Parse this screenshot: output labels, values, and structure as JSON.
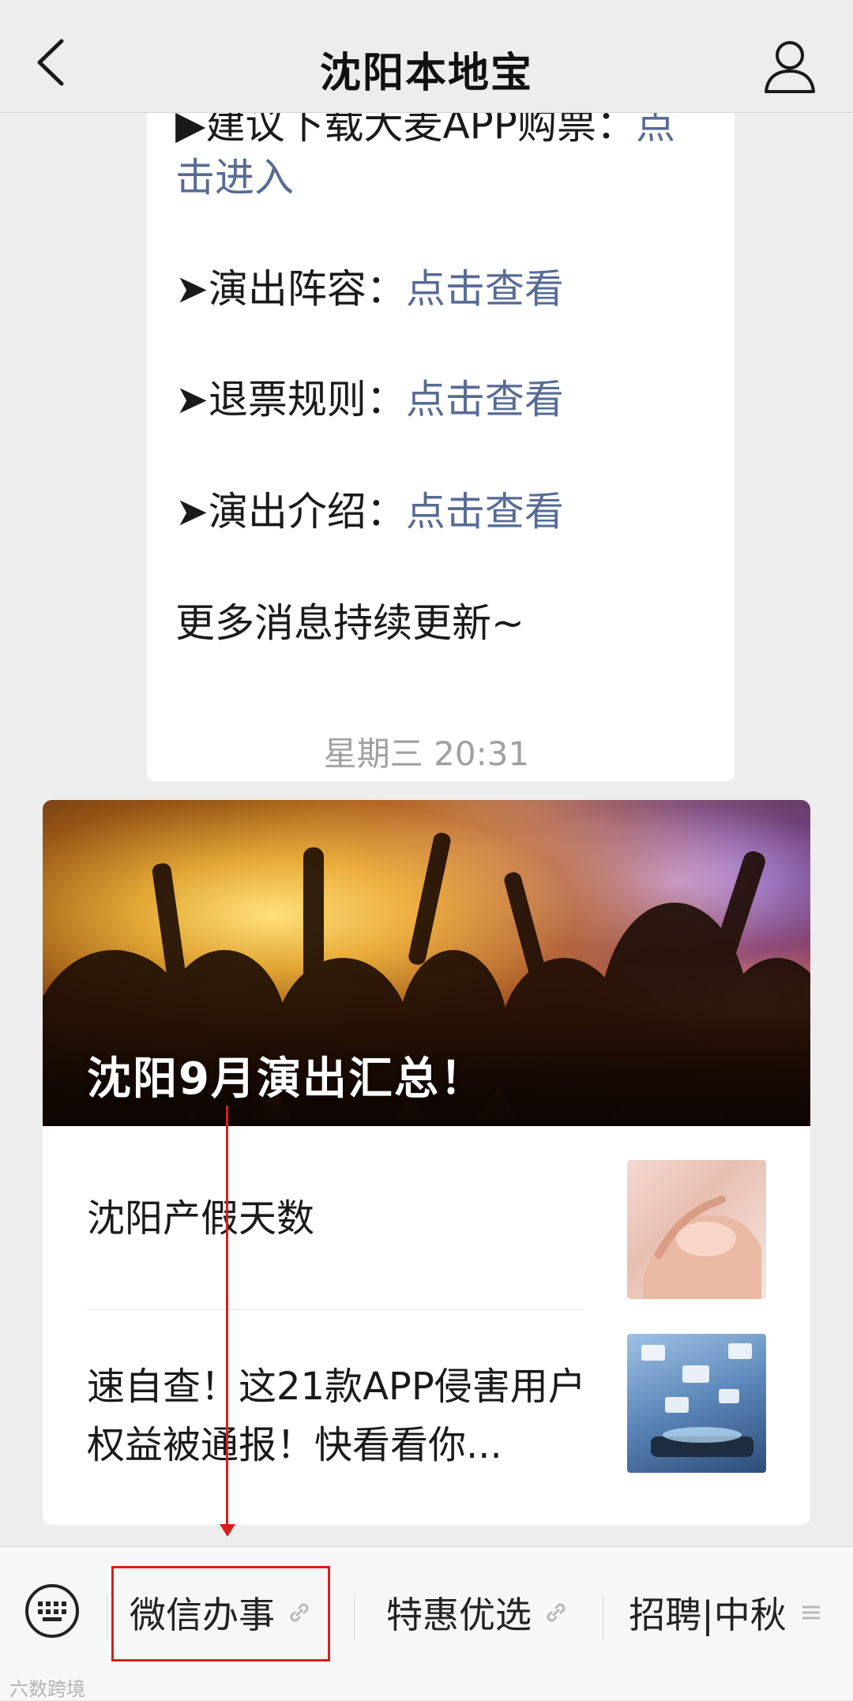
{
  "nav": {
    "title": "沈阳本地宝"
  },
  "message": {
    "lines": [
      {
        "text": "▶建议下载大麦APP购票：",
        "link": "点"
      },
      {
        "text": "",
        "link": "击进入"
      },
      {
        "text": "➤演出阵容：",
        "link": "点击查看"
      },
      {
        "text": "➤退票规则：",
        "link": "点击查看"
      },
      {
        "text": "➤演出介绍：",
        "link": "点击查看"
      },
      {
        "text": "更多消息持续更新~",
        "link": ""
      }
    ]
  },
  "timestamp": "星期三 20:31",
  "article": {
    "cover_title": "沈阳9月演出汇总！",
    "items": [
      {
        "title": "沈阳产假天数"
      },
      {
        "title": "速自查！这21款APP侵害用户权益被通报！快看看你..."
      }
    ]
  },
  "bottom_menu": {
    "items": [
      {
        "label": "微信办事",
        "icon": "link-icon"
      },
      {
        "label": "特惠优选",
        "icon": "link-icon"
      },
      {
        "label": "招聘|中秋",
        "icon": "menu-lines-icon"
      }
    ]
  },
  "watermark": "六数跨境",
  "colors": {
    "link": "#576b95",
    "annotation": "#d81e1e",
    "background": "#ededed"
  }
}
